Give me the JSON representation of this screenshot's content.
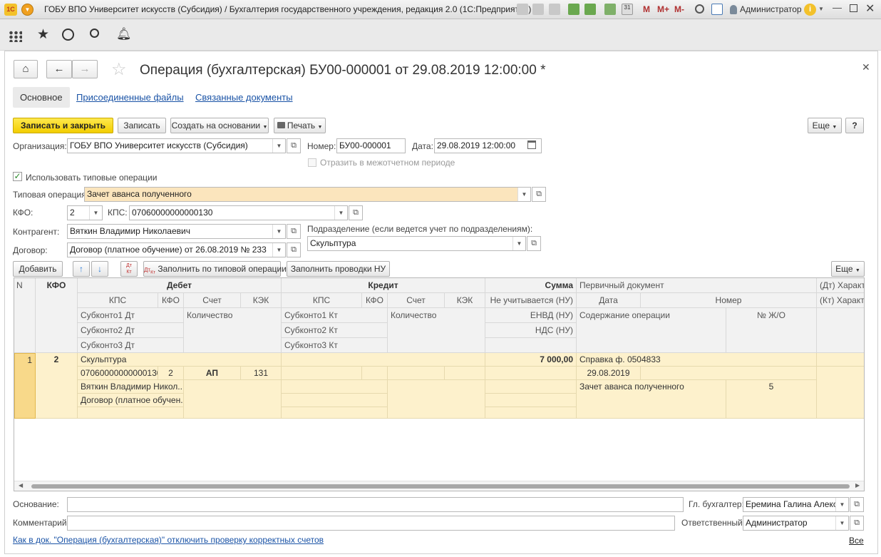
{
  "window": {
    "title": "ГОБУ ВПО Университет искусств (Субсидия) / Бухгалтерия государственного учреждения, редакция 2.0  (1С:Предприятие)",
    "user": "Администратор",
    "m": "M",
    "m_plus": "M+",
    "m_minus": "M-"
  },
  "form": {
    "title": "Операция (бухгалтерская) БУ00-000001 от 29.08.2019 12:00:00 *",
    "tabs": [
      "Основное",
      "Присоединенные файлы",
      "Связанные документы"
    ],
    "buttons": {
      "save_close": "Записать и закрыть",
      "save": "Записать",
      "create_based": "Создать на основании",
      "print": "Печать",
      "more": "Еще",
      "help": "?"
    },
    "org_label": "Организация:",
    "org_value": "ГОБУ ВПО Университет искусств (Субсидия)",
    "num_label": "Номер:",
    "num_value": "БУ00-000001",
    "date_label": "Дата:",
    "date_value": "29.08.2019 12:00:00",
    "reflect_label": "Отразить в межотчетном периоде",
    "use_typical_label": "Использовать типовые операции",
    "typical_op_label": "Типовая операция:",
    "typical_op_value": "Зачет аванса полученного",
    "kfo_label": "КФО:",
    "kfo_value": "2",
    "kps_label": "КПС:",
    "kps_value": "07060000000000130",
    "contractor_label": "Контрагент:",
    "contractor_value": "Вяткин Владимир Николаевич",
    "contract_label": "Договор:",
    "contract_value": "Договор (платное обучение) от 26.08.2019 № 233",
    "division_label": "Подразделение (если ведется учет по подразделениям):",
    "division_value": "Скульптура",
    "table_buttons": {
      "add": "Добавить",
      "fill_typical": "Заполнить по типовой операции",
      "fill_nu": "Заполнить проводки НУ",
      "more": "Еще",
      "dt": "Дт",
      "kt": "Кт"
    },
    "basis_label": "Основание:",
    "basis_value": "",
    "chief_label": "Гл. бухгалтер:",
    "chief_value": "Еремина Галина Алекса",
    "comment_label": "Комментарий:",
    "comment_value": "",
    "responsible_label": "Ответственный:",
    "responsible_value": "Администратор",
    "bottom_link": "Как в док. \"Операция (бухгалтерская)\" отключить проверку корректных счетов",
    "all_link": "Все"
  },
  "grid": {
    "headers": {
      "n": "N",
      "kfo": "КФО",
      "debit": "Дебет",
      "credit": "Кредит",
      "sum": "Сумма",
      "primary": "Первичный документ",
      "dt_char": "(Дт) Характе",
      "kps": "КПС",
      "kfo2": "КФО",
      "account": "Счет",
      "kek": "КЭК",
      "not_taken": "Не учитывается (НУ)",
      "date": "Дата",
      "number": "Номер",
      "kt_char": "(Кт) Характе",
      "subconto1_dt": "Субконто1 Дт",
      "quantity": "Количество",
      "subconto1_kt": "Субконто1 Кт",
      "envd": "ЕНВД (НУ)",
      "content": "Содержание операции",
      "jo": "№ Ж/О",
      "subconto2_dt": "Субконто2 Дт",
      "subconto2_kt": "Субконто2 Кт",
      "vat": "НДС (НУ)",
      "subconto3_dt": "Субконто3 Дт",
      "subconto3_kt": "Субконто3 Кт"
    },
    "row": {
      "n": "1",
      "kfo": "2",
      "d_sub1": "Скульптура",
      "d_kps": "07060000000000130",
      "d_kfo": "2",
      "d_account": "АП",
      "d_kek": "131",
      "d_sub2": "Вяткин Владимир Никол...",
      "d_sub3": "Договор (платное обучен...",
      "sum": "7 000,00",
      "doc": "Справка ф. 0504833",
      "doc_date": "29.08.2019",
      "content": "Зачет аванса полученного",
      "jo": "5"
    }
  }
}
